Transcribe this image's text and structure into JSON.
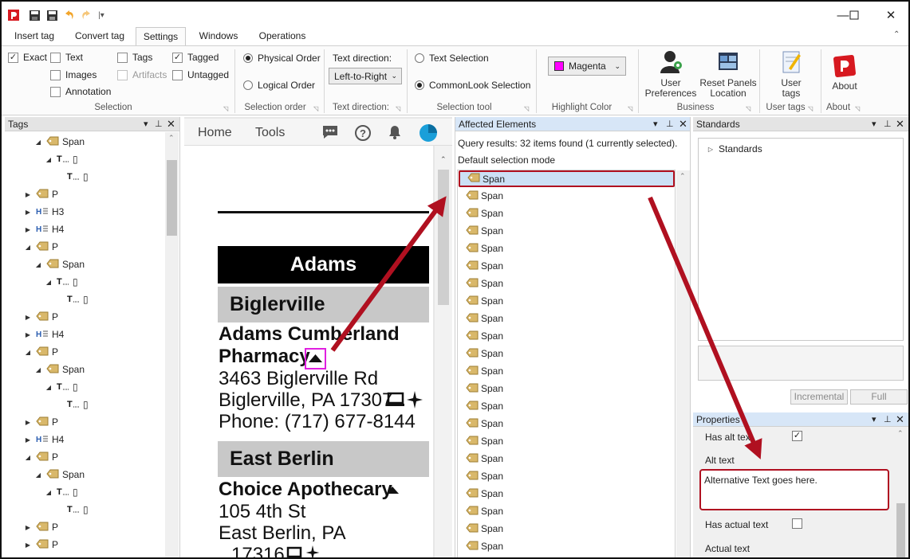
{
  "titlebar": {
    "minimize_icon": "window-minimize-icon",
    "maximize_icon": "window-maximize-icon",
    "close_icon": "window-close-icon"
  },
  "ribbon_tabs": [
    "Insert tag",
    "Convert tag",
    "Settings",
    "Windows",
    "Operations"
  ],
  "active_tab": "Settings",
  "ribbon": {
    "selection": {
      "label": "Selection",
      "exact": {
        "label": "Exact",
        "checked": true
      },
      "text": {
        "label": "Text",
        "checked": false
      },
      "images": {
        "label": "Images",
        "checked": false
      },
      "annotation": {
        "label": "Annotation",
        "checked": false
      },
      "tags": {
        "label": "Tags",
        "checked": false
      },
      "artifacts": {
        "label": "Artifacts",
        "checked": false,
        "disabled": true
      },
      "tagged": {
        "label": "Tagged",
        "checked": true
      },
      "untagged": {
        "label": "Untagged",
        "checked": false
      }
    },
    "selection_order": {
      "label": "Selection order",
      "physical": "Physical Order",
      "logical": "Logical Order"
    },
    "text_direction": {
      "label": "Text direction:",
      "caption": "Text direction:",
      "value": "Left-to-Right"
    },
    "selection_tool": {
      "label": "Selection tool",
      "text_selection": "Text Selection",
      "commonlook_selection": "CommonLook Selection"
    },
    "highlight_color": {
      "label": "Highlight Color",
      "value": "Magenta",
      "swatch": "#ff00ff"
    },
    "business": {
      "label": "Business",
      "user_prefs": [
        "User",
        "Preferences"
      ],
      "reset_panels": [
        "Reset Panels",
        "Location"
      ]
    },
    "user_tags": {
      "label": "User tags",
      "button": [
        "User",
        "tags"
      ]
    },
    "about": {
      "label": "About",
      "button": "About"
    }
  },
  "tags_panel": {
    "title": "Tags",
    "rows": [
      {
        "indent": 1,
        "arrow": "open",
        "icon": "tag",
        "label": "Span"
      },
      {
        "indent": 2,
        "arrow": "open",
        "icon": "text",
        "label": "▯"
      },
      {
        "indent": 3,
        "arrow": "none",
        "icon": "text",
        "label": "▯"
      },
      {
        "indent": 0,
        "arrow": "closed",
        "icon": "tag",
        "label": "P"
      },
      {
        "indent": 0,
        "arrow": "closed",
        "icon": "heading",
        "label": "H3"
      },
      {
        "indent": 0,
        "arrow": "closed",
        "icon": "heading",
        "label": "H4"
      },
      {
        "indent": 0,
        "arrow": "open",
        "icon": "tag",
        "label": "P"
      },
      {
        "indent": 1,
        "arrow": "open",
        "icon": "tag",
        "label": "Span"
      },
      {
        "indent": 2,
        "arrow": "open",
        "icon": "text",
        "label": "▯"
      },
      {
        "indent": 3,
        "arrow": "none",
        "icon": "text",
        "label": "▯"
      },
      {
        "indent": 0,
        "arrow": "closed",
        "icon": "tag",
        "label": "P"
      },
      {
        "indent": 0,
        "arrow": "closed",
        "icon": "heading",
        "label": "H4"
      },
      {
        "indent": 0,
        "arrow": "open",
        "icon": "tag",
        "label": "P"
      },
      {
        "indent": 1,
        "arrow": "open",
        "icon": "tag",
        "label": "Span"
      },
      {
        "indent": 2,
        "arrow": "open",
        "icon": "text",
        "label": "▯"
      },
      {
        "indent": 3,
        "arrow": "none",
        "icon": "text",
        "label": "▯"
      },
      {
        "indent": 0,
        "arrow": "closed",
        "icon": "tag",
        "label": "P"
      },
      {
        "indent": 0,
        "arrow": "closed",
        "icon": "heading",
        "label": "H4"
      },
      {
        "indent": 0,
        "arrow": "open",
        "icon": "tag",
        "label": "P"
      },
      {
        "indent": 1,
        "arrow": "open",
        "icon": "tag",
        "label": "Span"
      },
      {
        "indent": 2,
        "arrow": "open",
        "icon": "text",
        "label": "▯"
      },
      {
        "indent": 3,
        "arrow": "none",
        "icon": "text",
        "label": "▯"
      },
      {
        "indent": 0,
        "arrow": "closed",
        "icon": "tag",
        "label": "P"
      },
      {
        "indent": 0,
        "arrow": "closed",
        "icon": "tag",
        "label": "P"
      }
    ]
  },
  "document": {
    "nav": {
      "home": "Home",
      "tools": "Tools"
    },
    "county": "Adams",
    "city1": "Biglerville",
    "pharmacy1": {
      "name1": "Adams Cumberland",
      "name2": "Pharmacy",
      "address": "3463 Biglerville Rd",
      "citystate": "Biglerville, PA 17307",
      "phone": "Phone: (717) 677-8144"
    },
    "city2": "East Berlin",
    "pharmacy2": {
      "name": "Choice Apothecary",
      "address": "105 4th St",
      "citystate": "East Berlin, PA",
      "zip": "17316"
    }
  },
  "affected": {
    "title": "Affected Elements",
    "summary": "Query results: 32 items found (1 currently selected).",
    "mode": "Default selection mode",
    "items": [
      "Span",
      "Span",
      "Span",
      "Span",
      "Span",
      "Span",
      "Span",
      "Span",
      "Span",
      "Span",
      "Span",
      "Span",
      "Span",
      "Span",
      "Span",
      "Span",
      "Span",
      "Span",
      "Span",
      "Span",
      "Span",
      "Span"
    ]
  },
  "standards": {
    "title": "Standards",
    "root": "Standards",
    "incremental": "Incremental",
    "full": "Full"
  },
  "properties": {
    "title": "Properties",
    "has_alt_text": "Has alt text",
    "alt_text_label": "Alt text",
    "alt_text_value": "Alternative Text goes here.",
    "has_actual_text": "Has actual text",
    "actual_text_label": "Actual text"
  },
  "colors": {
    "annotation_red": "#b01020",
    "highlight": "#e020e0",
    "selection_blue": "#cce0f5"
  }
}
